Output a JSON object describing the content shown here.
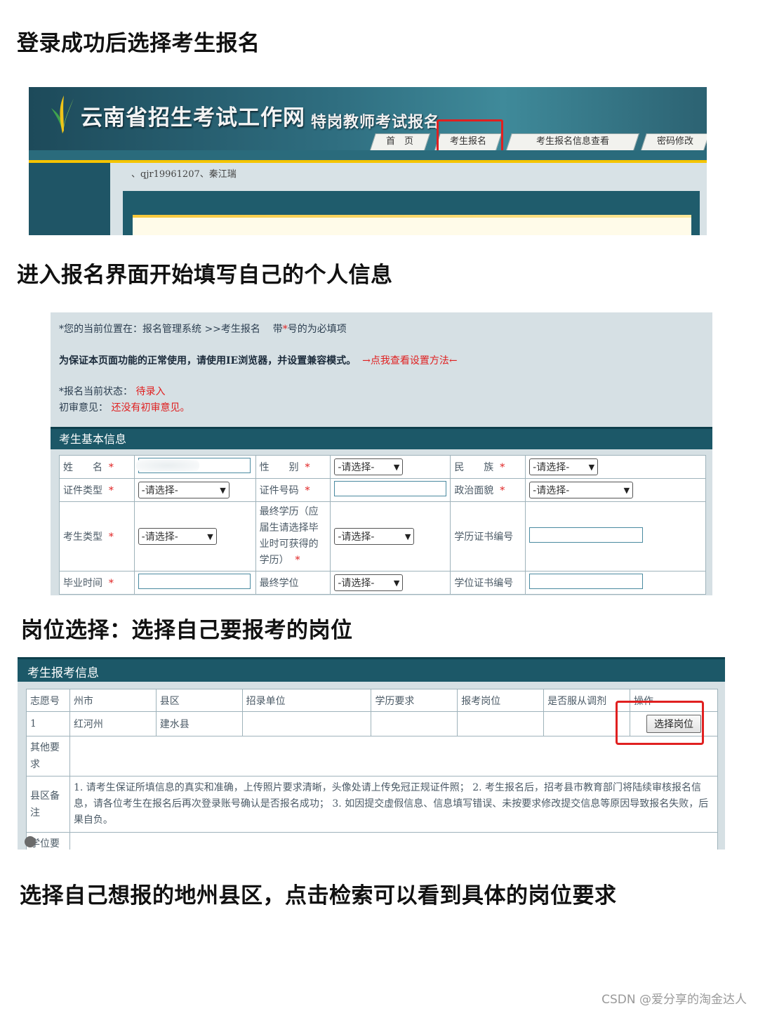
{
  "headings": {
    "h1": "登录成功后选择考生报名",
    "h2": "进入报名界面开始填写自己的个人信息",
    "h3": "岗位选择：选择自己要报考的岗位",
    "h4": "选择自己想报的地州县区，点击检索可以看到具体的岗位要求"
  },
  "portal": {
    "site_title": "云南省招生考试工作网",
    "sub_title": "特岗教师考试报名",
    "tabs": [
      "首　页",
      "考生报名",
      "考生报名信息查看",
      "密码修改"
    ],
    "user_line": "、qjr19961207、秦江瑞",
    "colors": {
      "header": "#1d4a5a",
      "accent_yellow": "#f5c400",
      "highlight_red": "#e02020"
    }
  },
  "form": {
    "location_prefix": "*您的当前位置在：报名管理系统 >>考生报名",
    "required_hint_pre": "带",
    "required_hint_star": "*",
    "required_hint_post": "号的为必填项",
    "browser_notice": "为保证本页面功能的正常使用，请使用IE浏览器，并设置兼容模式。",
    "browser_link": "→点我查看设置方法←",
    "status_label": "*报名当前状态：",
    "status_value": "待录入",
    "review_label": "初审意见：",
    "review_value": "还没有初审意见。",
    "section_title": "考生基本信息",
    "required_mark": "*",
    "select_placeholder": "-请选择-",
    "fields": {
      "name": "姓　　名",
      "gender": "性　　别",
      "ethnicity": "民　　族",
      "id_type": "证件类型",
      "id_number": "证件号码",
      "political": "政治面貌",
      "candidate_type": "考生类型",
      "final_edu": "最终学历（应届生请选择毕业时可获得的学历）",
      "edu_cert": "学历证书编号",
      "grad_time": "毕业时间",
      "final_degree": "最终学位",
      "degree_cert": "学位证书编号"
    }
  },
  "application": {
    "section_title": "考生报考信息",
    "columns": [
      "志愿号",
      "州市",
      "县区",
      "招录单位",
      "学历要求",
      "报考岗位",
      "是否服从调剂",
      "操作"
    ],
    "row": {
      "no": "1",
      "city": "红河州",
      "county": "建水县",
      "unit": "",
      "edu_req": "",
      "post": "",
      "adjust": ""
    },
    "select_button": "选择岗位",
    "other_req_label": "其他要求",
    "county_note_label": "县区备注",
    "county_note": "1. 请考生保证所填信息的真实和准确，上传照片要求清晰，头像处请上传免冠正规证件照； 2. 考生报名后，招考县市教育部门将陆续审核报名信息，请各位考生在报名后再次登录账号确认是否报名成功； 3. 如因提交虚假信息、信息填写错误、未按要求修改提交信息等原因导致报名失败，后果自负。",
    "degree_req_label": "学位要"
  },
  "watermark": "CSDN @爱分享的淘金达人"
}
